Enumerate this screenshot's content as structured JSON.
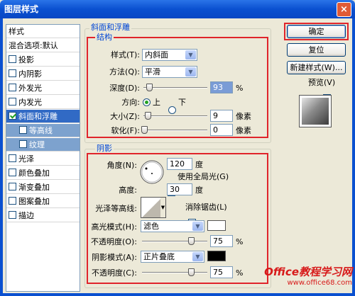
{
  "window": {
    "title": "图层样式",
    "close_glyph": "×"
  },
  "sidebar": {
    "header": "样式",
    "blend": "混合选项:默认",
    "items": [
      {
        "label": "投影",
        "checked": false
      },
      {
        "label": "内阴影",
        "checked": false
      },
      {
        "label": "外发光",
        "checked": false
      },
      {
        "label": "内发光",
        "checked": false
      },
      {
        "label": "斜面和浮雕",
        "checked": true
      },
      {
        "label": "等高线",
        "checked": false
      },
      {
        "label": "纹理",
        "checked": false
      },
      {
        "label": "光泽",
        "checked": false
      },
      {
        "label": "颜色叠加",
        "checked": false
      },
      {
        "label": "渐变叠加",
        "checked": false
      },
      {
        "label": "图案叠加",
        "checked": false
      },
      {
        "label": "描边",
        "checked": false
      }
    ]
  },
  "bevel": {
    "group_title": "斜面和浮雕",
    "structure_title": "结构",
    "style_label": "样式(T):",
    "style_value": "内斜面",
    "technique_label": "方法(Q):",
    "technique_value": "平滑",
    "depth_label": "深度(D):",
    "depth_value": "93",
    "depth_unit": "%",
    "depth_pct": 0.09,
    "direction_label": "方向:",
    "dir_up": "上",
    "dir_down": "下",
    "size_label": "大小(Z):",
    "size_value": "9",
    "size_unit": "像素",
    "soften_label": "软化(F):",
    "soften_value": "0",
    "soften_unit": "像素"
  },
  "shading": {
    "title": "阴影",
    "angle_label": "角度(N):",
    "angle_value": "120",
    "angle_unit": "度",
    "global_light": "使用全局光(G)",
    "global_light_checked": true,
    "altitude_label": "高度:",
    "altitude_value": "30",
    "altitude_unit": "度",
    "gloss_label": "光泽等高线:",
    "antialias": "消除锯齿(L)",
    "antialias_checked": false,
    "highlight_label": "高光模式(H):",
    "highlight_value": "滤色",
    "highlight_color": "#ffffff",
    "opacity1_label": "不透明度(O):",
    "opacity1_value": "75",
    "opacity1_unit": "%",
    "shadow_label": "阴影模式(A):",
    "shadow_value": "正片叠底",
    "shadow_color": "#000000",
    "opacity2_label": "不透明度(C):",
    "opacity2_value": "75",
    "opacity2_unit": "%"
  },
  "buttons": {
    "ok": "确定",
    "reset": "复位",
    "new_style": "新建样式(W)...",
    "preview": "预览(V)",
    "preview_checked": true
  },
  "watermark": {
    "line1": "Office教程学习网",
    "line2": "www.office68.com"
  }
}
